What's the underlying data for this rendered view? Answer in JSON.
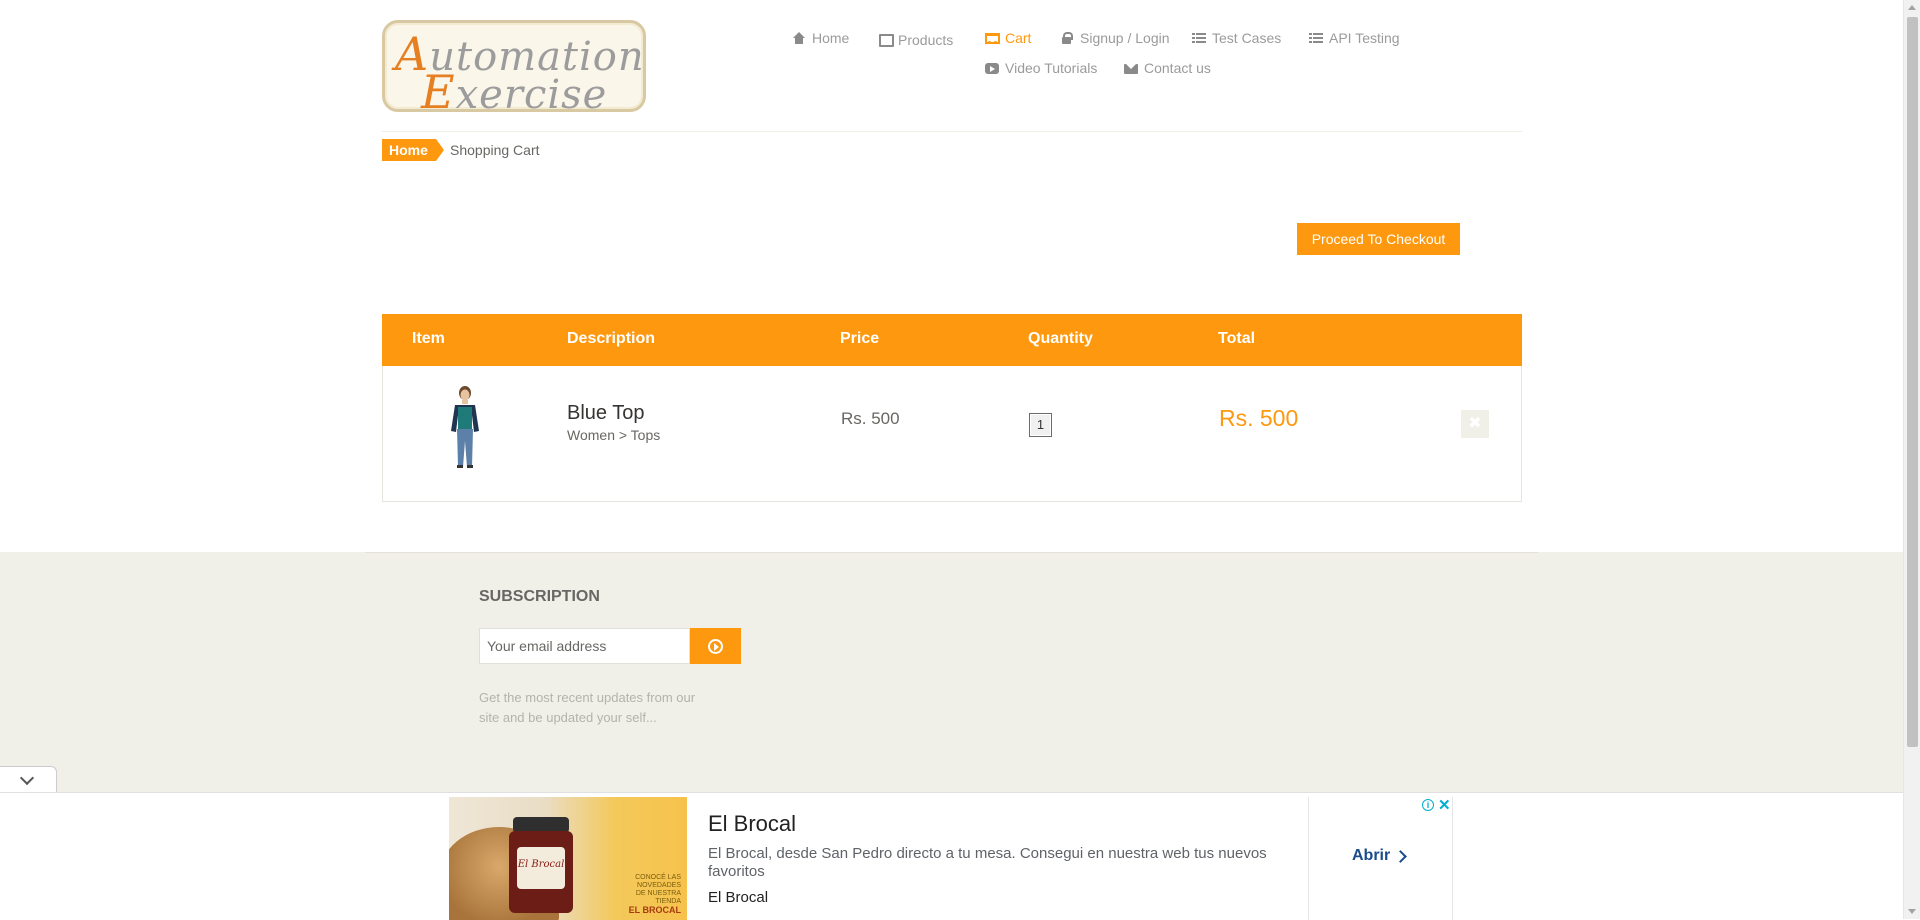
{
  "logo": {
    "line1_cap": "A",
    "line1_rest": "utomation",
    "line2_cap": "E",
    "line2_rest": "xercise"
  },
  "nav": {
    "items": [
      {
        "label": "Home",
        "icon": "home-icon"
      },
      {
        "label": "Products",
        "icon": "box-icon"
      },
      {
        "label": "Cart",
        "icon": "cart-icon",
        "active": true
      },
      {
        "label": "Signup / Login",
        "icon": "lock-icon"
      },
      {
        "label": "Test Cases",
        "icon": "list-icon"
      },
      {
        "label": "API Testing",
        "icon": "list-icon"
      },
      {
        "label": "Video Tutorials",
        "icon": "youtube-icon"
      },
      {
        "label": "Contact us",
        "icon": "envelope-icon"
      }
    ]
  },
  "breadcrumb": {
    "home": "Home",
    "current": "Shopping Cart"
  },
  "checkout": {
    "label": "Proceed To Checkout"
  },
  "cart": {
    "headers": {
      "item": "Item",
      "description": "Description",
      "price": "Price",
      "quantity": "Quantity",
      "total": "Total"
    },
    "rows": [
      {
        "name": "Blue Top",
        "category": "Women > Tops",
        "price": "Rs. 500",
        "quantity": "1",
        "total": "Rs. 500",
        "delete_icon": "times-icon"
      }
    ]
  },
  "footer": {
    "subscription_title": "SUBSCRIPTION",
    "email_placeholder": "Your email address",
    "subscribe_icon": "arrow-circle-right-icon",
    "subscription_text": "Get the most recent updates from our site and be updated your self..."
  },
  "ad": {
    "title": "El Brocal",
    "description": "El Brocal, desde San Pedro directo a tu mesa. Consegui en nuestra web tus nuevos favoritos",
    "advertiser": "El Brocal",
    "cta": "Abrir",
    "image_label": "El Brocal",
    "promo_line1": "CONOCÉ LAS",
    "promo_line2": "NOVEDADES",
    "promo_line3": "DE NUESTRA",
    "promo_line4": "TIENDA",
    "promo_brand": "EL BROCAL"
  },
  "colors": {
    "accent": "#fe980f",
    "footer_bg": "#f0f0e9",
    "text": "#696763",
    "ad_cta": "#1a4b8c"
  }
}
